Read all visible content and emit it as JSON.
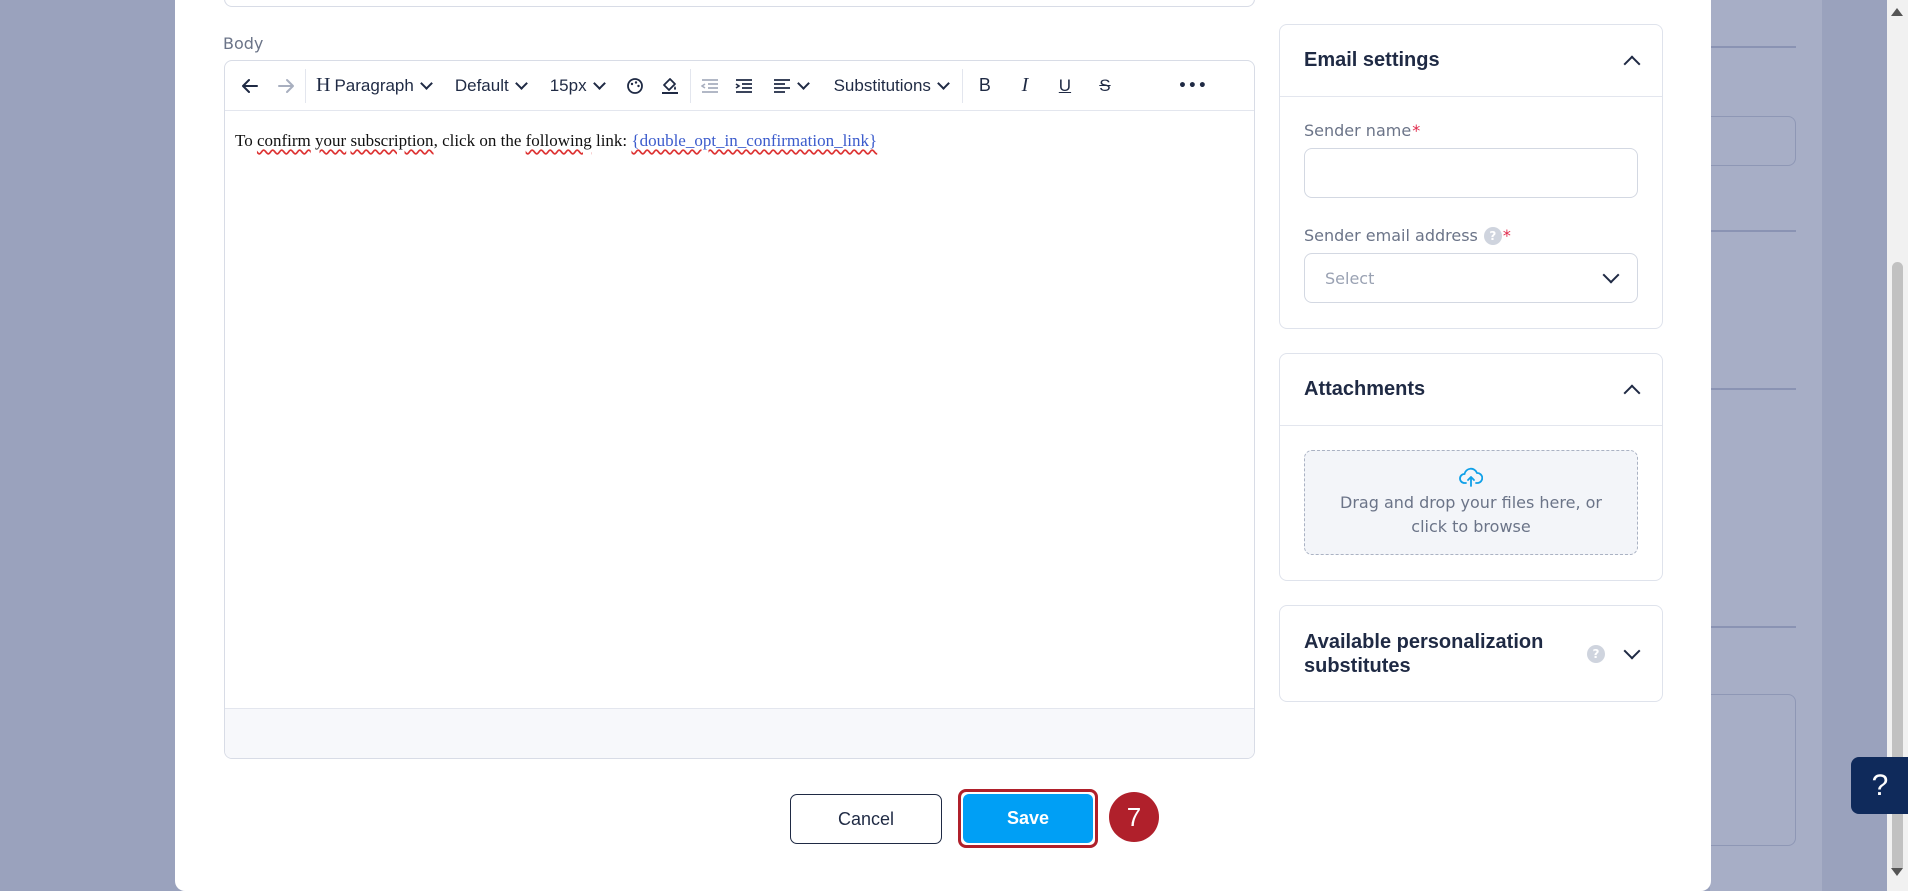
{
  "editor": {
    "body_label": "Body",
    "toolbar": {
      "paragraph_label": "Paragraph",
      "font_label": "Default",
      "size_label": "15px",
      "substitutions_label": "Substitutions",
      "bold_glyph": "B",
      "italic_glyph": "I",
      "underline_glyph": "U",
      "strike_glyph": "S",
      "more_glyph": "•••",
      "heading_glyph": "H"
    },
    "content": {
      "text_parts": [
        "To ",
        "confirm",
        " ",
        "your",
        " ",
        "subscription",
        ", click on the ",
        "following",
        " link: "
      ],
      "link_text": "{double_opt_in_confirmation_link}"
    }
  },
  "email_settings": {
    "title": "Email settings",
    "sender_name_label": "Sender name",
    "sender_email_label": "Sender email address",
    "required_mark": "*",
    "help_glyph": "?",
    "sender_email_placeholder": "Select"
  },
  "attachments": {
    "title": "Attachments",
    "dropzone_text": "Drag and drop your files here, or click to browse"
  },
  "personalization": {
    "title": "Available personalization substitutes",
    "help_glyph": "?"
  },
  "actions": {
    "cancel_label": "Cancel",
    "save_label": "Save",
    "step_number": "7"
  },
  "help_button": {
    "label": "?"
  },
  "colors": {
    "primary": "#009ff5",
    "highlight": "#b0202b",
    "navy": "#0f2a5b",
    "required": "#e0284a"
  }
}
